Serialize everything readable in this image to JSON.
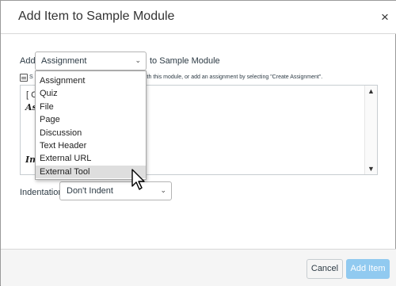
{
  "dialog": {
    "title": "Add Item to Sample Module",
    "close_glyph": "×"
  },
  "form": {
    "add_label": "Add",
    "item_type_selected": "Assignment",
    "to_module": "to Sample Module",
    "hint_start": "S",
    "hint_text": "ith this module, or add an assignment by selecting \"Create Assignment\".",
    "listbox": {
      "line1": "[ C",
      "bold1": "As",
      "bold2": "Im"
    },
    "indentation_label": "Indentation:",
    "indentation_selected": "Don't Indent"
  },
  "dropdown": {
    "items": [
      "Assignment",
      "Quiz",
      "File",
      "Page",
      "Discussion",
      "Text Header",
      "External URL",
      "External Tool"
    ],
    "highlighted_index": 7
  },
  "footer": {
    "cancel": "Cancel",
    "add_item": "Add Item"
  },
  "icons": {
    "close": "close-icon",
    "chevron": "chevron-down-icon",
    "hint": "document-icon",
    "cursor": "mouse-pointer-icon"
  },
  "colors": {
    "primary_button": "#91caf0",
    "highlight": "#dedede",
    "text": "#2d3b45"
  }
}
